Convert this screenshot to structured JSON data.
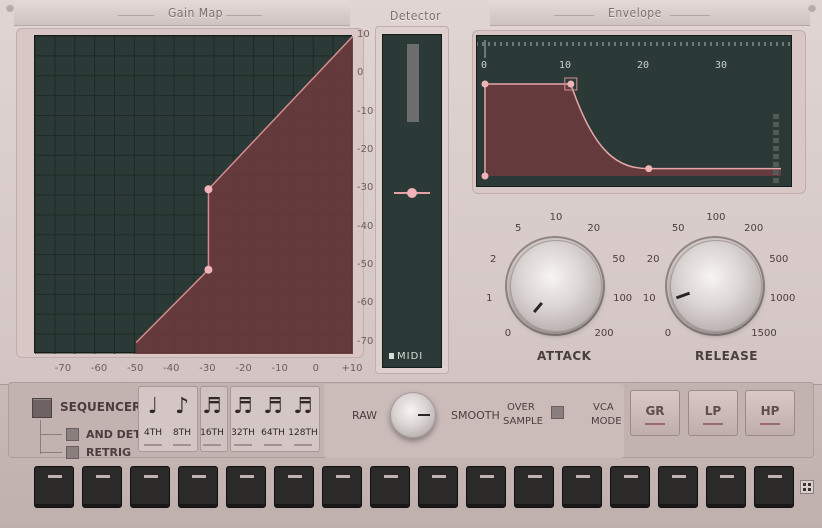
{
  "headers": {
    "gain_map": "Gain Map",
    "detector": "Detector",
    "envelope": "Envelope"
  },
  "gain_map": {
    "y_ticks": [
      "10",
      "0",
      "-10",
      "-20",
      "-30",
      "-40",
      "-50",
      "-60",
      "-70"
    ],
    "x_ticks": [
      "-70",
      "-60",
      "-50",
      "-40",
      "-30",
      "-20",
      "-10",
      "0",
      "+10"
    ],
    "curve_points": [
      [
        -50,
        -70
      ],
      [
        -30,
        -51
      ],
      [
        -30,
        -30
      ],
      [
        10,
        10
      ]
    ]
  },
  "detector": {
    "midi_label": "MIDI",
    "level": -30
  },
  "envelope": {
    "ticks": [
      "0",
      "10",
      "20",
      "30"
    ],
    "points": [
      [
        0,
        0
      ],
      [
        11,
        0
      ],
      [
        21,
        0.92
      ]
    ]
  },
  "attack": {
    "title": "ATTACK",
    "scale": [
      "0",
      "1",
      "2",
      "5",
      "10",
      "20",
      "50",
      "100",
      "200"
    ]
  },
  "release": {
    "title": "RELEASE",
    "scale": [
      "0",
      "10",
      "20",
      "50",
      "100",
      "200",
      "500",
      "1000",
      "1500"
    ]
  },
  "sequencer": {
    "label": "SEQUENCER",
    "and_det": "AND DET",
    "retrig": "RETRIG",
    "notes": [
      {
        "glyph": "♩",
        "label": "4TH"
      },
      {
        "glyph": "♪",
        "label": "8TH"
      },
      {
        "glyph": "♬",
        "label": "16TH"
      },
      {
        "glyph": "♬",
        "label": "32TH"
      },
      {
        "glyph": "♬",
        "label": "64TH"
      },
      {
        "glyph": "♬",
        "label": "128TH"
      }
    ],
    "steps": 16
  },
  "detector_mode": {
    "raw": "RAW",
    "smooth": "SMOOTH"
  },
  "oversample": {
    "line1": "OVER",
    "line2": "SAMPLE"
  },
  "vca": {
    "line1": "VCA",
    "line2": "MODE"
  },
  "mode_buttons": [
    "GR",
    "LP",
    "HP"
  ],
  "colors": {
    "screen": "#2b3a36",
    "curve_fill": "#6e3b3e",
    "accent": "#f0b3b6"
  }
}
